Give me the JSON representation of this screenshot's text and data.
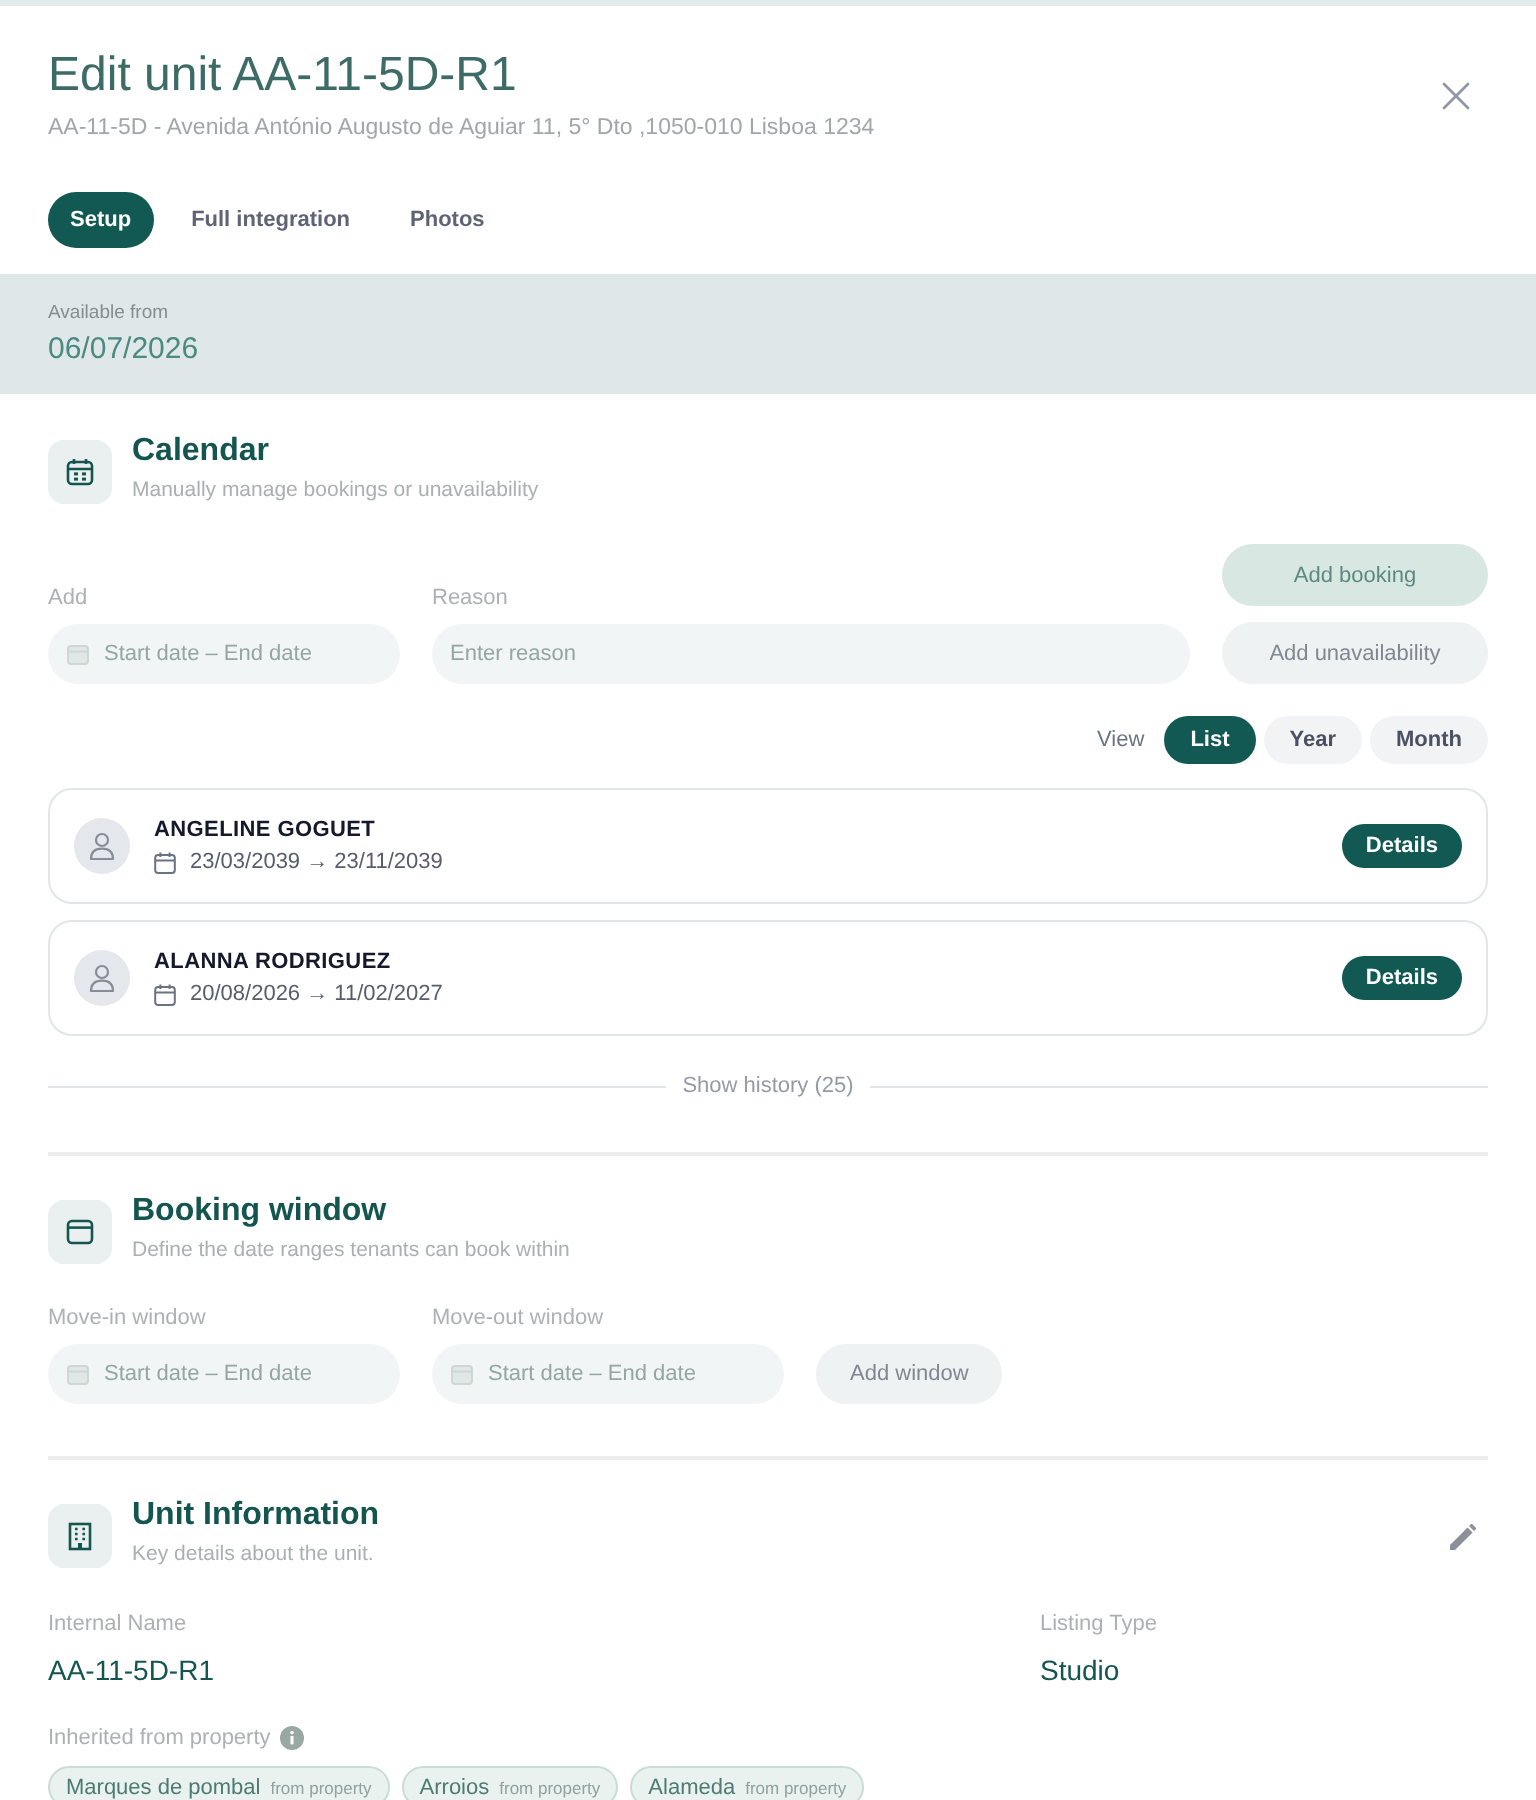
{
  "dialog": {
    "title": "Edit unit AA-11-5D-R1",
    "subtitle": "AA-11-5D - Avenida António Augusto de Aguiar 11, 5° Dto ,1050-010 Lisboa 1234"
  },
  "tabs": [
    {
      "label": "Setup",
      "selected": true
    },
    {
      "label": "Full integration",
      "selected": false
    },
    {
      "label": "Photos",
      "selected": false
    }
  ],
  "availability": {
    "label": "Available from",
    "value": "06/07/2026"
  },
  "calendar": {
    "title": "Calendar",
    "subtitle": "Manually manage bookings or unavailability",
    "fields": [
      {
        "kind": "date_range",
        "label": "Add",
        "placeholder": "Start date – End date"
      },
      {
        "kind": "text",
        "label": "Reason",
        "placeholder": "Enter reason"
      }
    ],
    "buttons": [
      {
        "label": "Add booking",
        "kind": "primary"
      },
      {
        "label": "Add unavailability",
        "kind": "secondary"
      }
    ],
    "view": {
      "label": "View",
      "options": [
        {
          "label": "List",
          "selected": true
        },
        {
          "label": "Year",
          "selected": false
        },
        {
          "label": "Month",
          "selected": false
        }
      ]
    },
    "bookings": [
      {
        "name": "ANGELINE GOGUET",
        "dates": "23/03/2039 → 23/11/2039",
        "action": "Details"
      },
      {
        "name": "ALANNA RODRIGUEZ",
        "dates": "20/08/2026 → 11/02/2027",
        "action": "Details"
      }
    ],
    "history": "Show history (25)"
  },
  "booking_window": {
    "title": "Booking window",
    "subtitle": "Define the date ranges tenants can book within",
    "fields": [
      {
        "kind": "date_range",
        "label": "Move-in window",
        "placeholder": "Start date – End date"
      },
      {
        "kind": "date_range",
        "label": "Move-out window",
        "placeholder": "Start date – End date"
      }
    ],
    "button": {
      "label": "Add window",
      "kind": "secondary"
    }
  },
  "unit_information": {
    "title": "Unit Information",
    "subtitle": "Key details about the unit.",
    "fields": [
      {
        "label": "Internal Name",
        "value": "AA-11-5D-R1"
      },
      {
        "label": "Listing Type",
        "value": "Studio"
      }
    ],
    "inherited": {
      "label": "Inherited from property",
      "tags": [
        {
          "name": "Marques de pombal",
          "source": "from property"
        },
        {
          "name": "Arroios",
          "source": "from property"
        },
        {
          "name": "Alameda",
          "source": "from property"
        }
      ]
    }
  }
}
